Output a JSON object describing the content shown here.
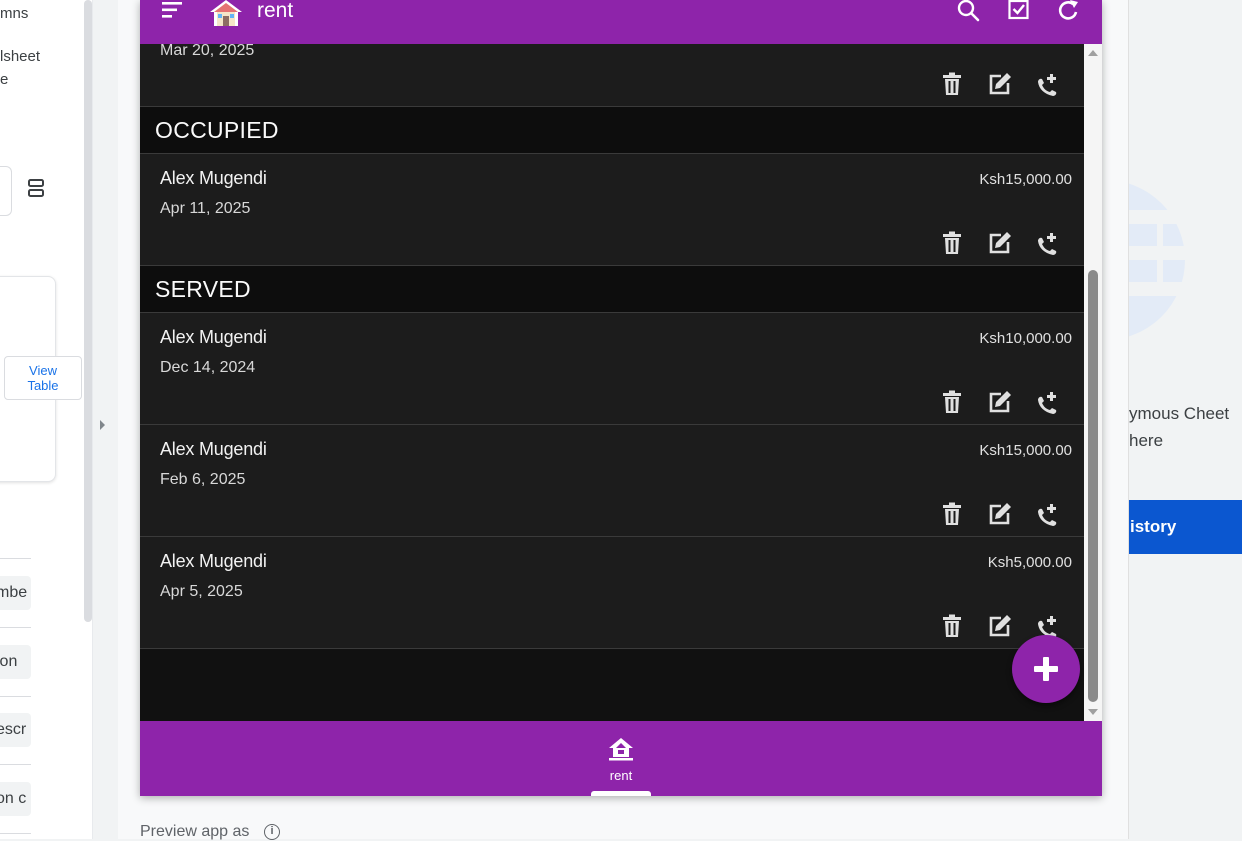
{
  "editor": {
    "columns_label": "mns",
    "spreadsheet_line1": "lsheet",
    "spreadsheet_line2": "e",
    "view_table_line1": "View",
    "view_table_line2": "Table",
    "fields": [
      "mbe",
      "ion",
      "escr",
      "on c"
    ]
  },
  "app": {
    "title": "rent",
    "icons": {
      "menu": "menu-icon",
      "home": "house-icon",
      "search": "search-icon",
      "select": "checkbox-icon",
      "refresh": "refresh-icon"
    },
    "groups": [
      {
        "header": "",
        "items": [
          {
            "name": "",
            "date": "Mar 20, 2025",
            "amount": ""
          }
        ]
      },
      {
        "header": "OCCUPIED",
        "items": [
          {
            "name": "Alex Mugendi",
            "date": "Apr 11, 2025",
            "amount": "Ksh15,000.00"
          }
        ]
      },
      {
        "header": "SERVED",
        "items": [
          {
            "name": "Alex Mugendi",
            "date": "Dec 14, 2024",
            "amount": "Ksh10,000.00"
          },
          {
            "name": "Alex Mugendi",
            "date": "Feb 6, 2025",
            "amount": "Ksh15,000.00"
          },
          {
            "name": "Alex Mugendi",
            "date": "Apr 5, 2025",
            "amount": "Ksh5,000.00"
          }
        ]
      }
    ],
    "item_actions": [
      "trash-icon",
      "edit-icon",
      "phone-icon"
    ],
    "fab_icon": "plus-icon",
    "bottom_nav": {
      "label": "rent",
      "icon": "house-icon"
    },
    "colors": {
      "primary": "#8e24aa",
      "surface": "#1c1c1c",
      "background": "#111111"
    }
  },
  "preview": {
    "label": "Preview app as"
  },
  "right_panel": {
    "line1": "ymous Cheet",
    "line2": "here",
    "button_label": "istory",
    "button_color": "#0b57d0"
  }
}
